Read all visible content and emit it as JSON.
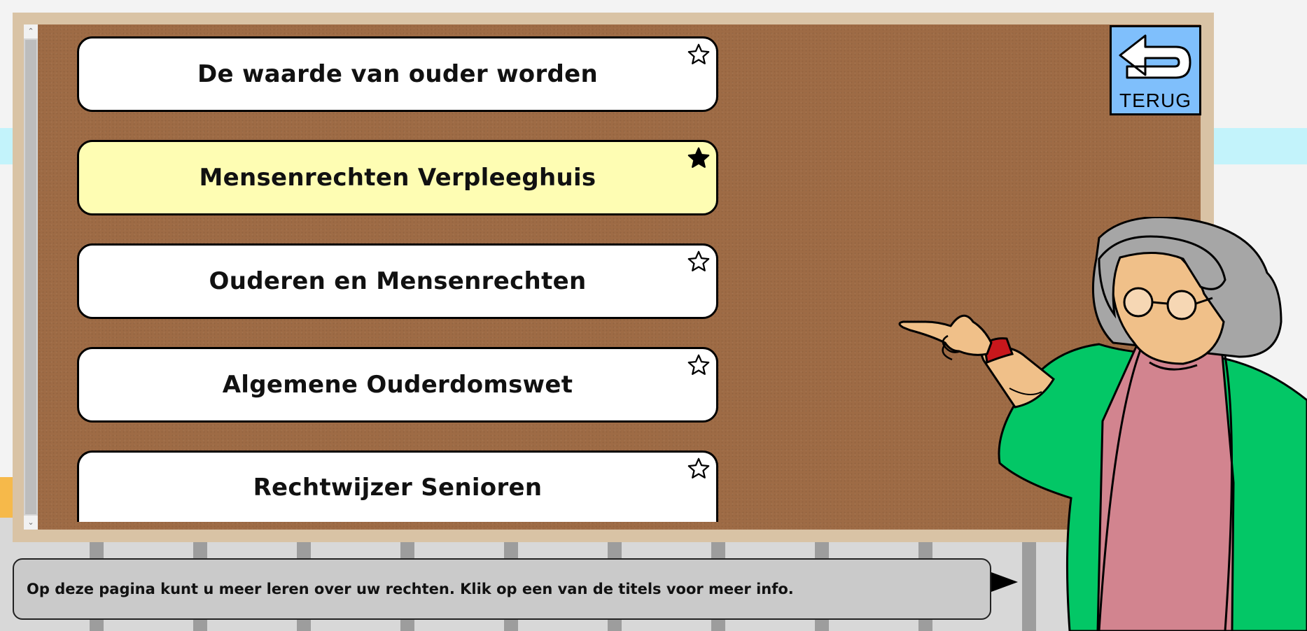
{
  "menu": {
    "items": [
      {
        "title": "De waarde van ouder worden",
        "favorite": false
      },
      {
        "title": "Mensenrechten Verpleeghuis",
        "favorite": true
      },
      {
        "title": "Ouderen en Mensenrechten",
        "favorite": false
      },
      {
        "title": "Algemene Ouderdomswet",
        "favorite": false
      },
      {
        "title": "Rechtwijzer Senioren",
        "favorite": false
      }
    ]
  },
  "back_button": {
    "label": "TERUG"
  },
  "speech": {
    "text": "Op deze pagina kunt u meer leren over uw rechten. Klik op een van de titels voor meer info."
  },
  "colors": {
    "cork": "#9e6b45",
    "frame": "#d9c3a5",
    "active_item": "#fefdb3",
    "back_button": "#7fbffc",
    "cardigan": "#03c766",
    "shirt": "#d2848f",
    "hair": "#a6a6a6",
    "skin": "#f0c089"
  },
  "icons": {
    "favorite_off": "star-outline-icon",
    "favorite_on": "star-filled-icon",
    "back": "return-arrow-icon",
    "speech_next": "play-triangle-icon"
  }
}
